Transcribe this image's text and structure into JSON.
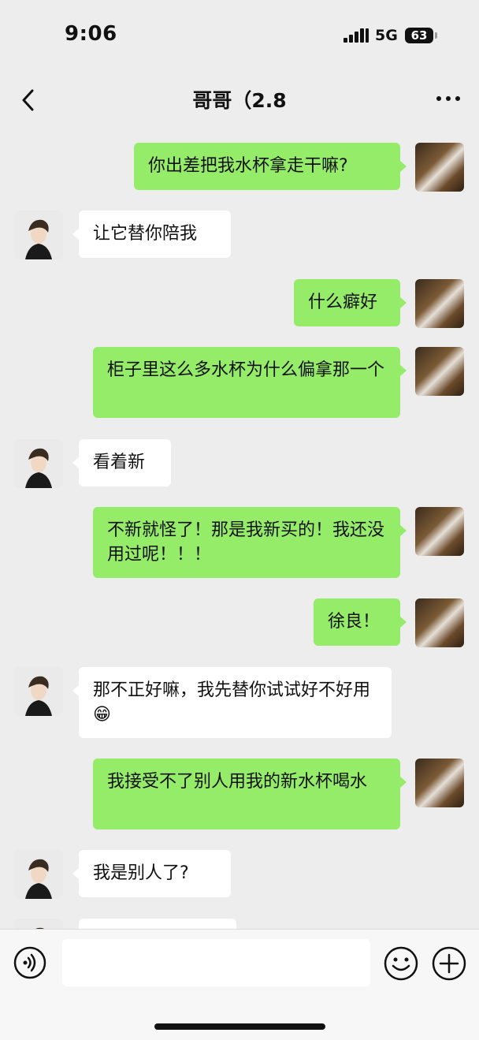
{
  "status_bar": {
    "time": "9:06",
    "network": "5G",
    "battery": "63"
  },
  "header": {
    "title": "哥哥（2.8",
    "back_icon": "chevron-left-icon",
    "more_icon": "more-dots-icon"
  },
  "messages": [
    {
      "side": "right",
      "text": "你出差把我水杯拿走干嘛?"
    },
    {
      "side": "left",
      "text": "让它替你陪我"
    },
    {
      "side": "right",
      "text": "什么癖好"
    },
    {
      "side": "right",
      "text": "柜子里这么多水杯为什么偏拿那一个"
    },
    {
      "side": "left",
      "text": "看着新"
    },
    {
      "side": "right",
      "text": "不新就怪了！那是我新买的！我还没用过呢！！！"
    },
    {
      "side": "right",
      "text": "徐良！"
    },
    {
      "side": "left",
      "text": "那不正好嘛，我先替你试试好不好用😁"
    },
    {
      "side": "right",
      "text": "我接受不了别人用我的新水杯喝水"
    },
    {
      "side": "left",
      "text": "我是别人了?"
    },
    {
      "side": "left",
      "text": ""
    }
  ],
  "input_bar": {
    "voice_icon": "voice-icon",
    "emoji_icon": "emoji-icon",
    "plus_icon": "plus-icon",
    "input_value": ""
  },
  "colors": {
    "outgoing_bubble": "#95ec69",
    "incoming_bubble": "#ffffff",
    "background": "#ededed"
  }
}
